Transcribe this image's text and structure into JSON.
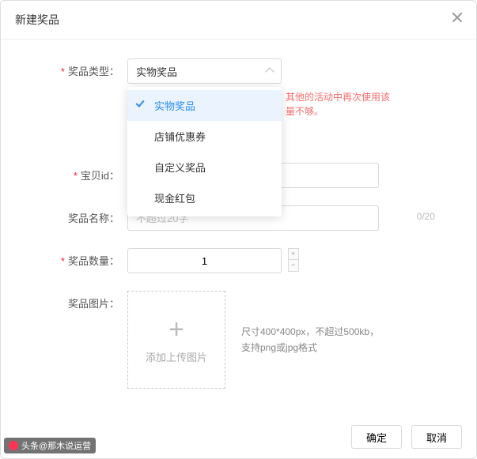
{
  "header": {
    "title": "新建奖品"
  },
  "form": {
    "type": {
      "label": "奖品类型：",
      "value": "实物奖品",
      "options": [
        "实物奖品",
        "店铺优惠券",
        "自定义奖品",
        "现金红包"
      ],
      "selected_index": 0,
      "hint_line1": "其他的活动中再次使用该",
      "hint_line2": "量不够。"
    },
    "item_id": {
      "label": "宝贝id：",
      "value": ""
    },
    "name": {
      "label": "奖品名称：",
      "placeholder": "不超过20字",
      "value": "",
      "count": "0/20"
    },
    "qty": {
      "label": "奖品数量：",
      "value": "1"
    },
    "image": {
      "label": "奖品图片：",
      "upload_text": "添加上传图片",
      "hint": "尺寸400*400px，不超过500kb，支持png或jpg格式"
    }
  },
  "footer": {
    "confirm": "确定",
    "cancel": "取消"
  },
  "watermark": "头条@那木说运营"
}
